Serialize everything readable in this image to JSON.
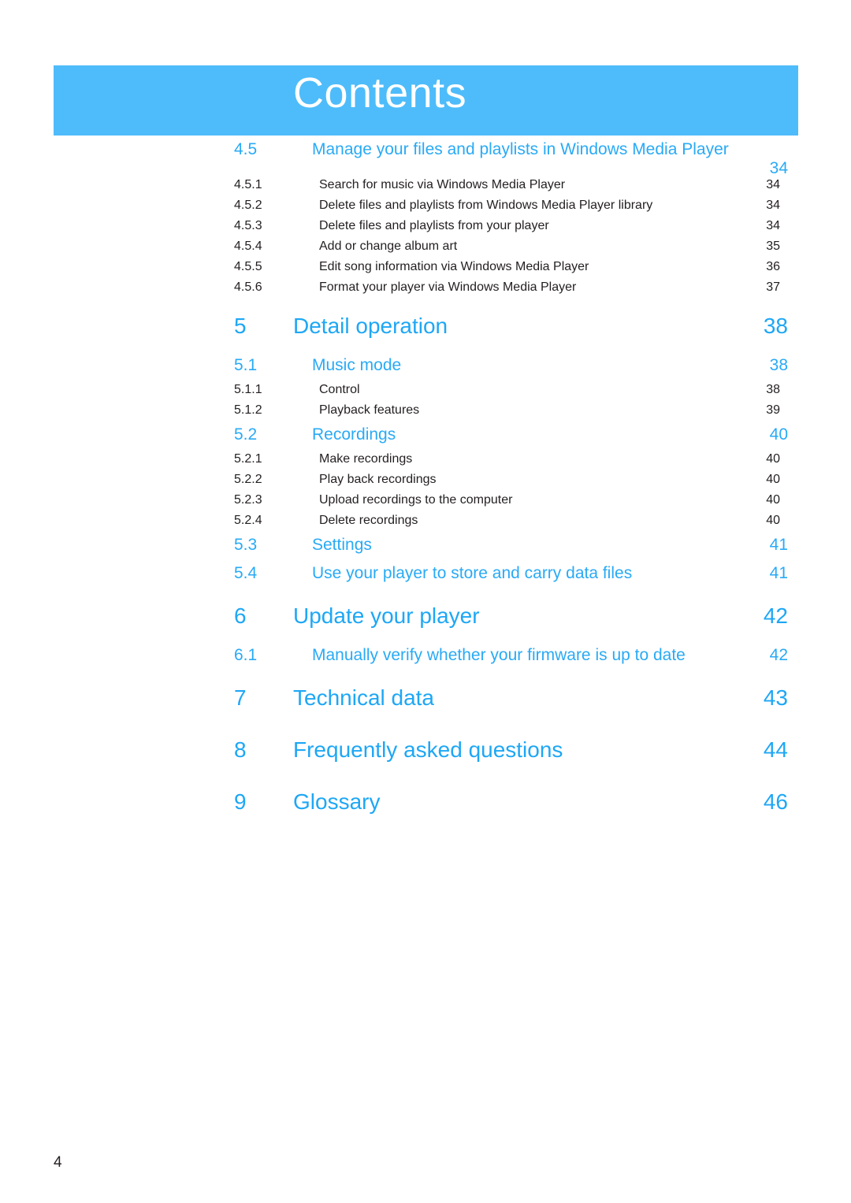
{
  "header": {
    "title": "Contents",
    "banner_color": "#4ebcfa",
    "title_color": "#ffffff"
  },
  "colors": {
    "chapter_blue": "#1ea7f5",
    "section_blue": "#29aaf5",
    "body_black": "#231f20",
    "banner": "#4ebcfa"
  },
  "footer": {
    "page_number": "4"
  },
  "toc": {
    "entries": [
      {
        "level": 2,
        "number": "4.5",
        "title": "Manage your files and playlists in Windows Media Player",
        "page": "34",
        "wrapped": true
      },
      {
        "level": 3,
        "number": "4.5.1",
        "title": "Search for music via Windows Media Player",
        "page": "34"
      },
      {
        "level": 3,
        "number": "4.5.2",
        "title": "Delete files and playlists from Windows Media Player library",
        "page": "34"
      },
      {
        "level": 3,
        "number": "4.5.3",
        "title": "Delete files and playlists from your player",
        "page": "34"
      },
      {
        "level": 3,
        "number": "4.5.4",
        "title": "Add or change album art",
        "page": "35"
      },
      {
        "level": 3,
        "number": "4.5.5",
        "title": "Edit song information via Windows Media Player",
        "page": "36"
      },
      {
        "level": 3,
        "number": "4.5.6",
        "title": "Format your player via Windows Media Player",
        "page": "37"
      },
      {
        "level": 1,
        "number": "5",
        "title": "Detail operation",
        "page": "38"
      },
      {
        "level": 2,
        "number": "5.1",
        "title": "Music mode",
        "page": "38"
      },
      {
        "level": 3,
        "number": "5.1.1",
        "title": "Control",
        "page": "38"
      },
      {
        "level": 3,
        "number": "5.1.2",
        "title": "Playback features",
        "page": "39"
      },
      {
        "level": 2,
        "number": "5.2",
        "title": "Recordings",
        "page": "40"
      },
      {
        "level": 3,
        "number": "5.2.1",
        "title": "Make recordings",
        "page": "40"
      },
      {
        "level": 3,
        "number": "5.2.2",
        "title": "Play back recordings",
        "page": "40"
      },
      {
        "level": 3,
        "number": "5.2.3",
        "title": "Upload recordings to the computer",
        "page": "40"
      },
      {
        "level": 3,
        "number": "5.2.4",
        "title": "Delete recordings",
        "page": "40"
      },
      {
        "level": 2,
        "number": "5.3",
        "title": "Settings",
        "page": "41"
      },
      {
        "level": 2,
        "number": "5.4",
        "title": "Use your player to store and carry data files",
        "page": "41"
      },
      {
        "level": 1,
        "number": "6",
        "title": "Update your player",
        "page": "42"
      },
      {
        "level": 2,
        "number": "6.1",
        "title": "Manually verify whether your firmware is up to date",
        "page": "42"
      },
      {
        "level": 1,
        "number": "7",
        "title": "Technical data",
        "page": "43"
      },
      {
        "level": 1,
        "number": "8",
        "title": "Frequently asked questions",
        "page": "44"
      },
      {
        "level": 1,
        "number": "9",
        "title": "Glossary",
        "page": "46"
      }
    ]
  }
}
